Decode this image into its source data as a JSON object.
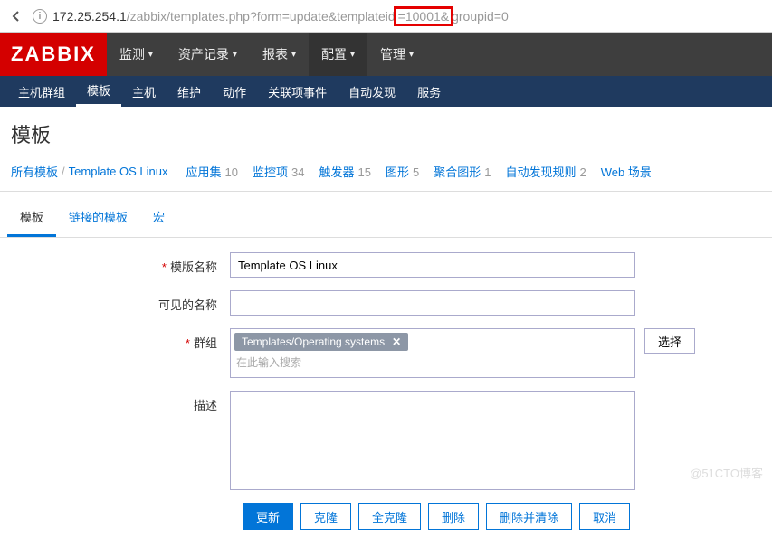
{
  "url": {
    "host": "172.25.254.1",
    "path_before": "/zabbix/templates.php?form=update&templateid",
    "highlight": "=10001&",
    "path_after": "groupid=0"
  },
  "logo": "ZABBIX",
  "topnav": [
    "监测",
    "资产记录",
    "报表",
    "配置",
    "管理"
  ],
  "topnav_active": 3,
  "subnav": [
    "主机群组",
    "模板",
    "主机",
    "维护",
    "动作",
    "关联项事件",
    "自动发现",
    "服务"
  ],
  "subnav_active": 1,
  "page_title": "模板",
  "breadcrumb": {
    "root": "所有模板",
    "current": "Template OS Linux"
  },
  "stats": [
    {
      "label": "应用集",
      "count": "10"
    },
    {
      "label": "监控项",
      "count": "34"
    },
    {
      "label": "触发器",
      "count": "15"
    },
    {
      "label": "图形",
      "count": "5"
    },
    {
      "label": "聚合图形",
      "count": "1"
    },
    {
      "label": "自动发现规则",
      "count": "2"
    },
    {
      "label": "Web 场景",
      "count": ""
    }
  ],
  "tabs": [
    "模板",
    "链接的模板",
    "宏"
  ],
  "tabs_active": 0,
  "form": {
    "name_label": "模版名称",
    "name_value": "Template OS Linux",
    "visible_label": "可见的名称",
    "visible_value": "",
    "group_label": "群组",
    "group_tag": "Templates/Operating systems",
    "group_placeholder": "在此输入搜索",
    "select_btn": "选择",
    "desc_label": "描述",
    "desc_value": ""
  },
  "buttons": {
    "update": "更新",
    "clone": "克隆",
    "fullclone": "全克隆",
    "delete": "删除",
    "deleteclear": "删除并清除",
    "cancel": "取消"
  },
  "watermark": "@51CTO博客"
}
